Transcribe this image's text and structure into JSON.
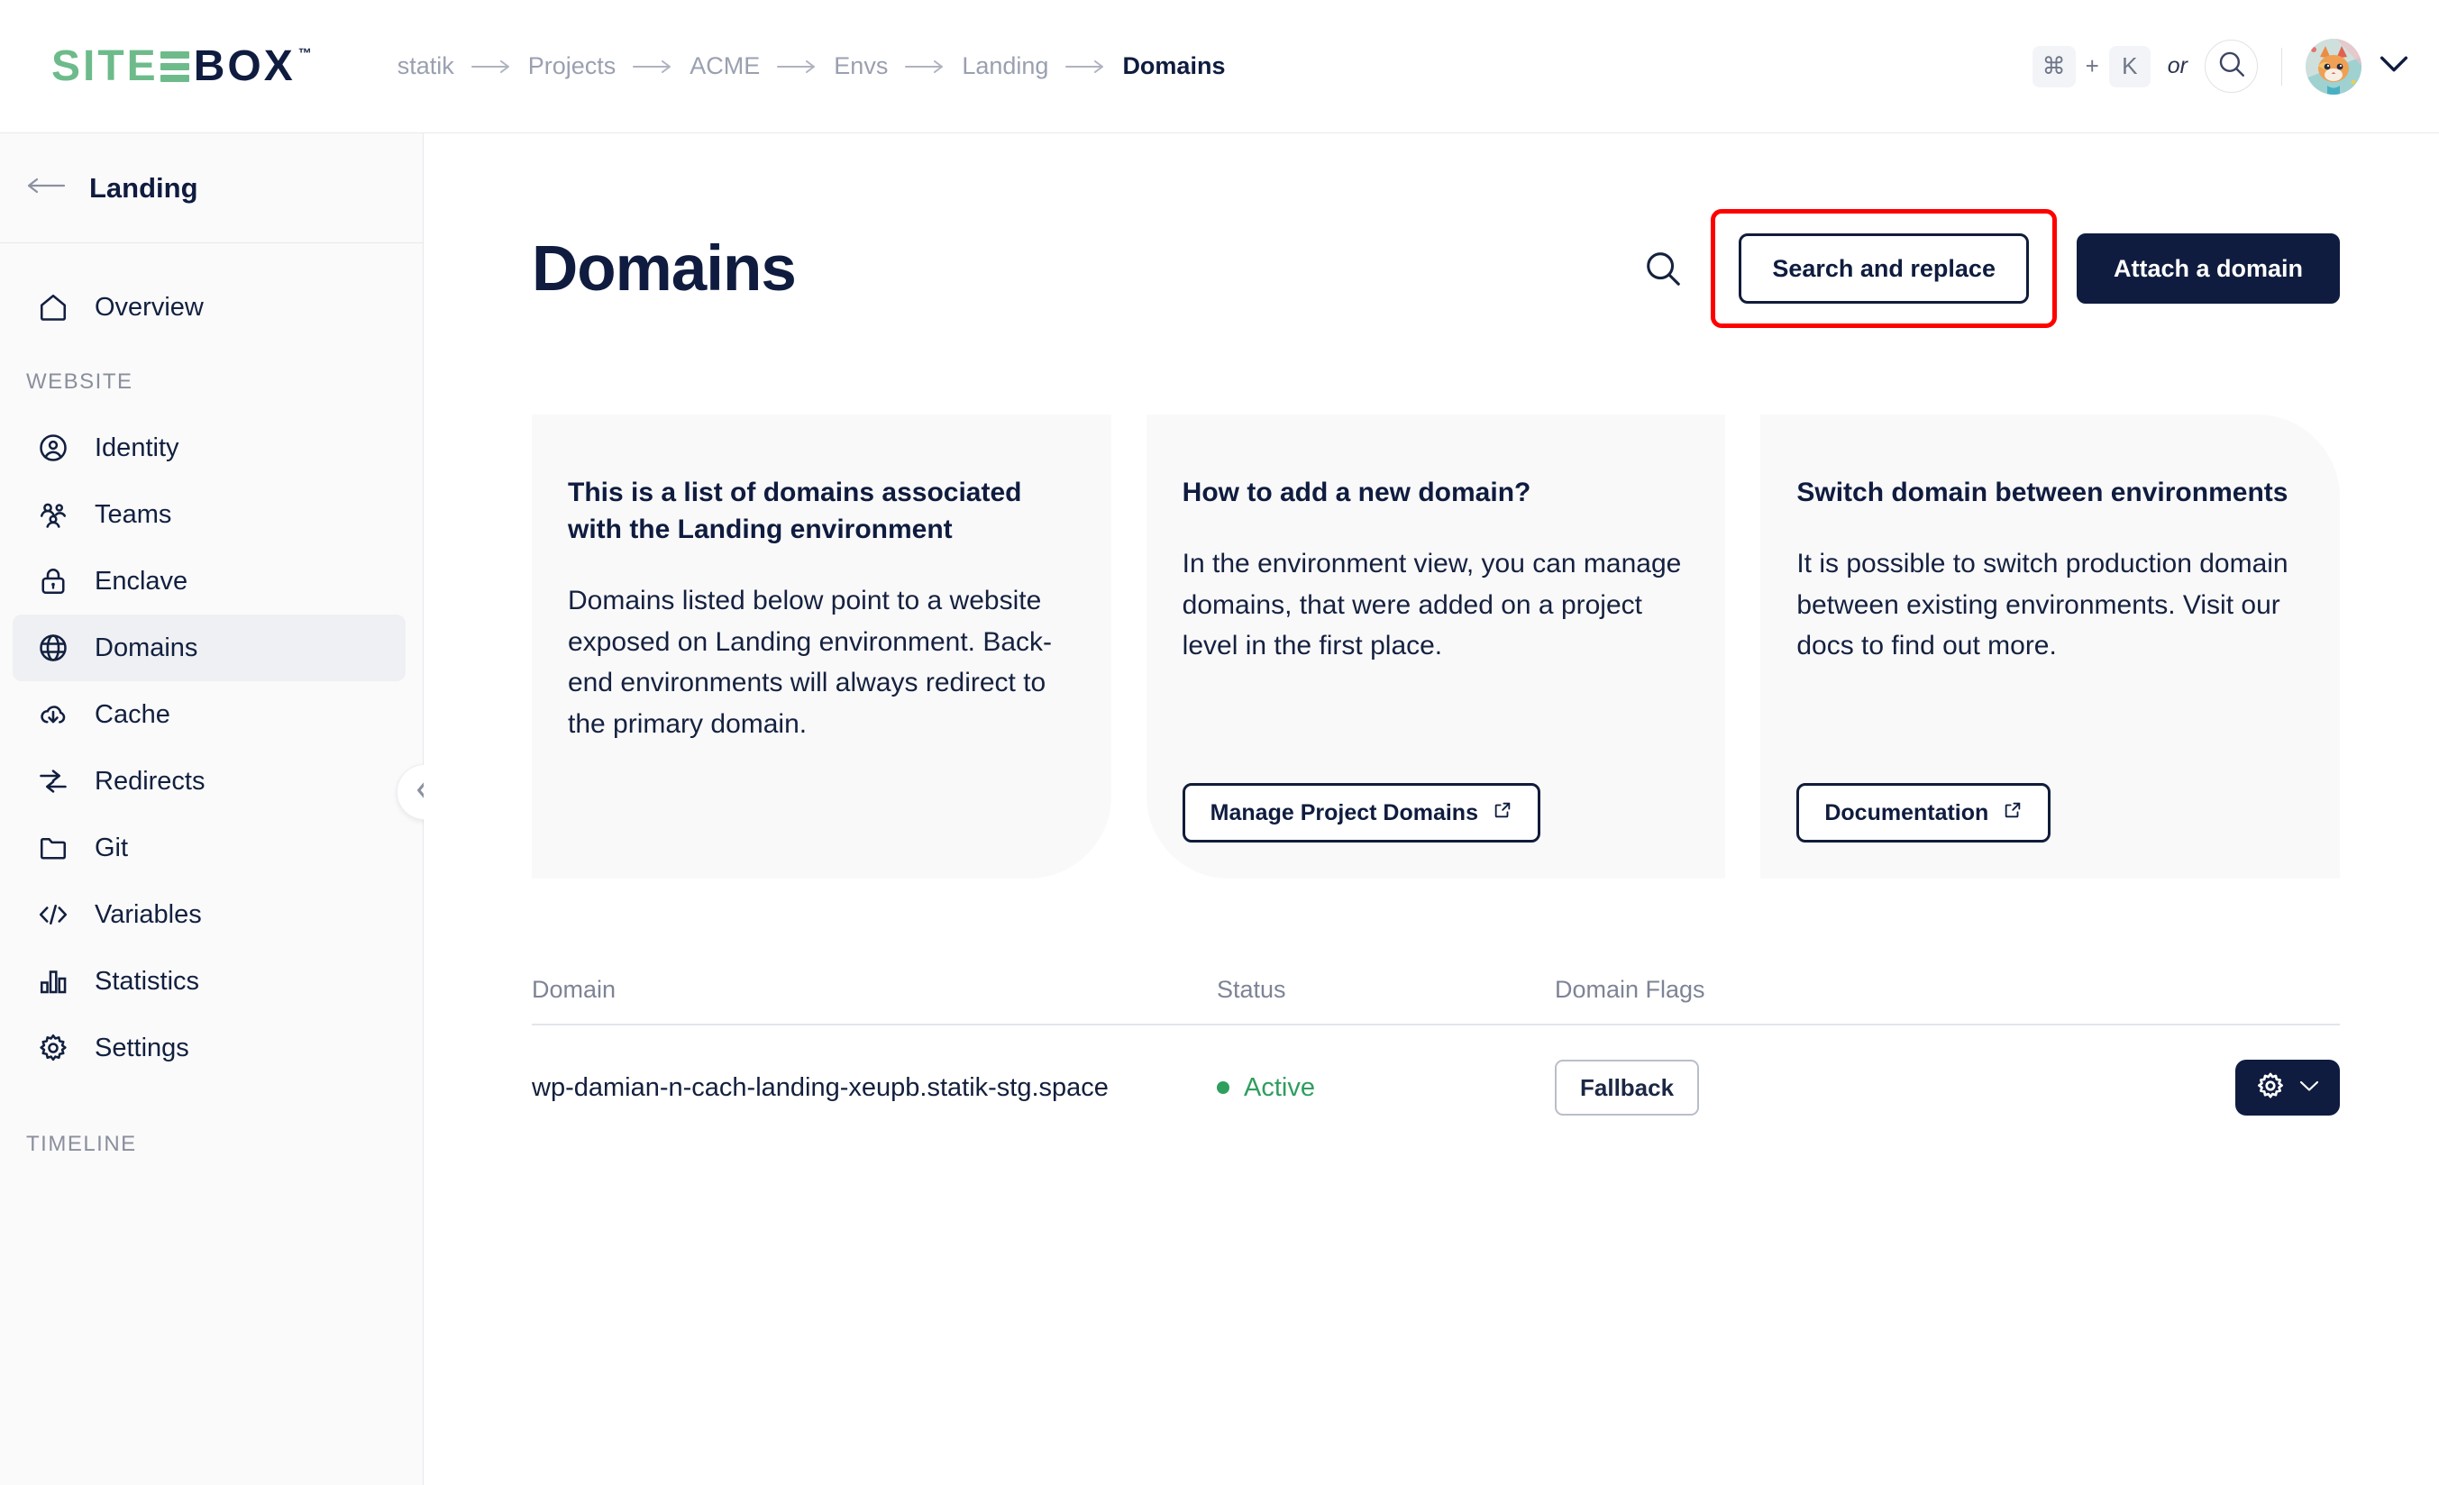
{
  "brand": {
    "name_part1": "SITE",
    "name_part2": "BOX",
    "trademark": "™",
    "green": "#6dbb8a",
    "navy": "#0f1c3f"
  },
  "topbar": {
    "breadcrumb": [
      {
        "label": "statik",
        "active": false
      },
      {
        "label": "Projects",
        "active": false
      },
      {
        "label": "ACME",
        "active": false
      },
      {
        "label": "Envs",
        "active": false
      },
      {
        "label": "Landing",
        "active": false
      },
      {
        "label": "Domains",
        "active": true
      }
    ],
    "separator": "⟶",
    "shortcut": {
      "modifier": "⌘",
      "plus": "+",
      "key": "K",
      "or_label": "or"
    },
    "search_icon": "search-icon",
    "avatar_alt": "cat-avatar",
    "user_chevron": "chevron-down-icon"
  },
  "sidebar": {
    "back_label": "Landing",
    "back_icon": "arrow-left-icon",
    "collapse_icon": "chevron-left-icon",
    "top_items": [
      {
        "label": "Overview",
        "icon": "home-icon",
        "active": false
      }
    ],
    "sections": [
      {
        "label": "WEBSITE",
        "items": [
          {
            "label": "Identity",
            "icon": "user-circle-icon",
            "active": false
          },
          {
            "label": "Teams",
            "icon": "users-icon",
            "active": false
          },
          {
            "label": "Enclave",
            "icon": "lock-icon",
            "active": false
          },
          {
            "label": "Domains",
            "icon": "globe-icon",
            "active": true
          },
          {
            "label": "Cache",
            "icon": "cloud-download-icon",
            "active": false
          },
          {
            "label": "Redirects",
            "icon": "redirect-arrows-icon",
            "active": false
          },
          {
            "label": "Git",
            "icon": "folder-icon",
            "active": false
          },
          {
            "label": "Variables",
            "icon": "code-icon",
            "active": false
          },
          {
            "label": "Statistics",
            "icon": "bar-chart-icon",
            "active": false
          },
          {
            "label": "Settings",
            "icon": "gear-icon",
            "active": false
          }
        ]
      },
      {
        "label": "TIMELINE",
        "items": []
      }
    ]
  },
  "main": {
    "title": "Domains",
    "search_icon": "search-icon",
    "search_replace_label": "Search and replace",
    "attach_domain_label": "Attach a domain",
    "highlight_color": "#ff0000"
  },
  "cards": [
    {
      "heading": "This is a list of domains associated with the Landing environment",
      "body": "Domains listed below point to a website exposed on Landing environment. Back-end environments will always redirect to the primary domain.",
      "button": null
    },
    {
      "heading": "How to add a new domain?",
      "body": "In the environment view, you can manage domains, that were added on a project level in the first place.",
      "button": {
        "label": "Manage Project Domains",
        "icon": "external-link-icon"
      }
    },
    {
      "heading": "Switch domain between environments",
      "body": "It is possible to switch production domain between existing environments. Visit our docs to find out more.",
      "button": {
        "label": "Documentation",
        "icon": "external-link-icon"
      }
    }
  ],
  "table": {
    "columns": [
      {
        "key": "domain",
        "label": "Domain"
      },
      {
        "key": "status",
        "label": "Status"
      },
      {
        "key": "flags",
        "label": "Domain Flags"
      }
    ],
    "rows": [
      {
        "domain": "wp-damian-n-cach-landing-xeupb.statik-stg.space",
        "status": "Active",
        "status_color": "#2f9e5f",
        "flag": "Fallback",
        "action_icon": "gear-icon",
        "action_chevron": "chevron-down-icon"
      }
    ]
  }
}
